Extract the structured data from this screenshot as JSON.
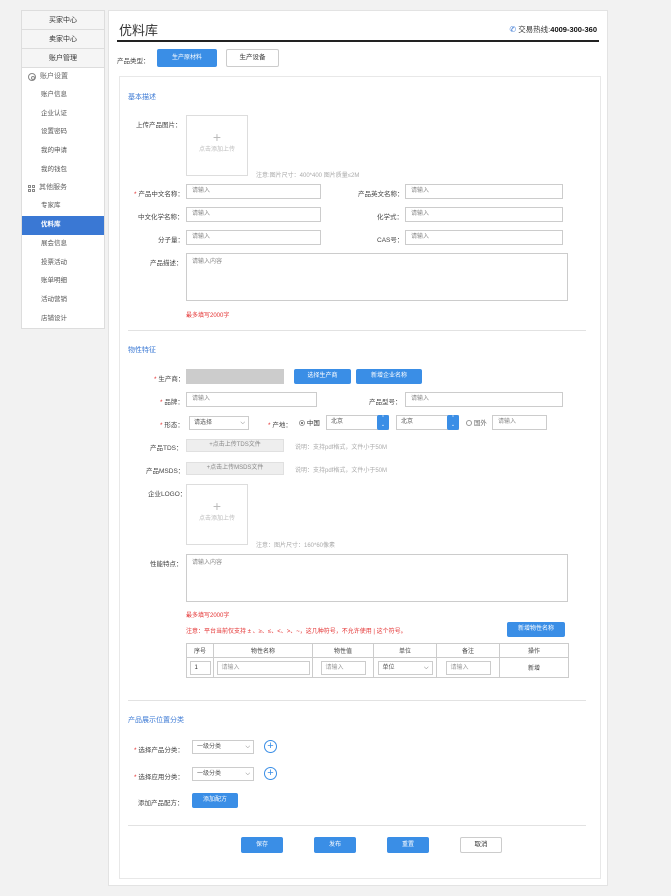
{
  "sidebar": {
    "buyer_center": "买家中心",
    "seller_center": "卖家中心",
    "account_management": "账户管理",
    "group1": {
      "label": "账户设置",
      "icon": "gear-icon",
      "items": [
        "账户信息",
        "企业认证",
        "设置密码",
        "我的申请",
        "我的钱包"
      ]
    },
    "group2": {
      "label": "其他服务",
      "icon": "grid-icon",
      "items": [
        "专家库",
        "优料库",
        "展会信息",
        "投票活动",
        "账单明细",
        "活动营销",
        "店铺设计"
      ]
    },
    "active_item": "优料库"
  },
  "header": {
    "title": "优料库",
    "hotline_label": "交易热线:",
    "hotline_number": "4009-300-360"
  },
  "product_type": {
    "label": "产品类型：",
    "options": [
      "生产原材料",
      "生产设备"
    ],
    "selected": "生产原材料"
  },
  "basic": {
    "section_title": "基本描述",
    "upload_label": "上传产品图片：",
    "upload_text": "点击添加上传",
    "upload_note": "注意:图片尺寸：400*400 图片质量≤2M",
    "cn_name_label": "产品中文名称：",
    "cn_name_placeholder": "请输入",
    "en_name_label": "产品英文名称：",
    "en_name_placeholder": "请输入",
    "chem_name_label": "中文化学名称：",
    "chem_name_placeholder": "请输入",
    "formula_label": "化学式：",
    "formula_placeholder": "请输入",
    "mw_label": "分子量：",
    "mw_placeholder": "请输入",
    "cas_label": "CAS号：",
    "cas_placeholder": "请输入",
    "desc_label": "产品描述：",
    "desc_placeholder": "请输入内容",
    "desc_limit": "最多填写2000字"
  },
  "physical": {
    "section_title": "物性特征",
    "producer_label": "生产商：",
    "choose_producer_btn": "选择生产商",
    "add_company_btn": "新增企业名称",
    "brand_label": "品牌：",
    "brand_placeholder": "请输入",
    "model_label": "产品型号：",
    "model_placeholder": "请输入",
    "form_label": "形态：",
    "form_select": "请选择",
    "origin_label": "产地：",
    "origin_china": "中国",
    "origin_city1": "北京",
    "origin_city2": "北京",
    "origin_foreign": "国外",
    "origin_foreign_placeholder": "请输入",
    "tds_label": "产品TDS：",
    "tds_btn": "+点击上传TDS文件",
    "tds_note": "说明：支持pdf格式，文件小于50M",
    "msds_label": "产品MSDS：",
    "msds_btn": "+点击上传MSDS文件",
    "msds_note": "说明：支持pdf格式，文件小于50M",
    "logo_label": "企业LOGO：",
    "logo_upload_text": "点击添加上传",
    "logo_note": "注意：图片尺寸：160*60像素",
    "perf_label": "性能特点：",
    "perf_placeholder": "请输入内容",
    "perf_limit": "最多填写2000字",
    "symbol_note": "注意：平台当前仅支持 ± 、≥、≤、<、>、~，这几种符号，不允许使用 | 这个符号。",
    "add_prop_btn": "新增物性名称",
    "table": {
      "headers": [
        "序号",
        "物性名称",
        "物性值",
        "单位",
        "备注",
        "操作"
      ],
      "row": {
        "index": "1",
        "name_placeholder": "请输入",
        "value_placeholder": "请输入",
        "unit": "单位",
        "remark_placeholder": "请输入",
        "action": "新增"
      }
    }
  },
  "display": {
    "section_title": "产品展示位置分类",
    "product_cat_label": "选择产品分类：",
    "product_cat_select": "一级分类",
    "app_cat_label": "选择应用分类：",
    "app_cat_select": "一级分类",
    "formula_label": "添加产品配方：",
    "formula_btn": "添加配方"
  },
  "footer": {
    "save": "保存",
    "publish": "发布",
    "reset": "重置",
    "cancel": "取消"
  },
  "colors": {
    "accent": "#3a8ee6",
    "active_nav": "#3a78d4",
    "required": "#e43030"
  }
}
